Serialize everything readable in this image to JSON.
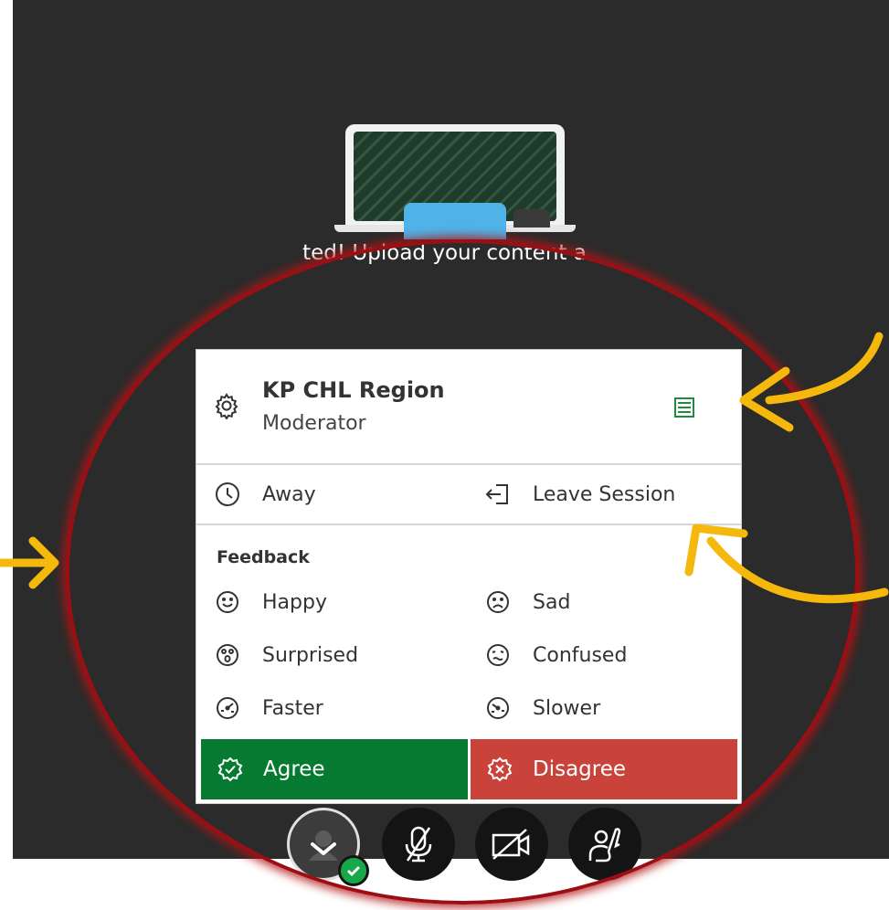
{
  "stage": {
    "welcome_text": "ted! Upload your content a"
  },
  "menu": {
    "user_name": "KP CHL Region",
    "user_role": "Moderator",
    "away_label": "Away",
    "leave_label": "Leave Session",
    "feedback_heading": "Feedback",
    "feedback_items": [
      {
        "label": "Happy",
        "icon": "happy-face-icon"
      },
      {
        "label": "Sad",
        "icon": "sad-face-icon"
      },
      {
        "label": "Surprised",
        "icon": "surprised-face-icon"
      },
      {
        "label": "Confused",
        "icon": "confused-face-icon"
      },
      {
        "label": "Faster",
        "icon": "faster-gauge-icon"
      },
      {
        "label": "Slower",
        "icon": "slower-gauge-icon"
      }
    ],
    "agree_label": "Agree",
    "disagree_label": "Disagree"
  },
  "colors": {
    "agree": "#067a30",
    "disagree": "#c9433a",
    "stage": "#2b2b2b",
    "highlight_ring": "#9b0f14",
    "annotation_arrow": "#f5b80c",
    "status_check": "#17a84a"
  },
  "controls": [
    "avatar-status-button",
    "microphone-muted-button",
    "camera-off-button",
    "raise-hand-button"
  ]
}
